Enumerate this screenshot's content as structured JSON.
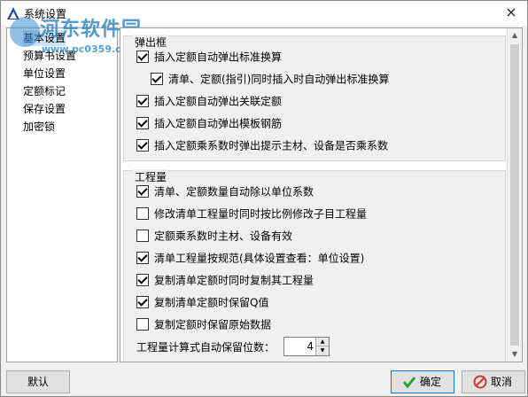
{
  "window": {
    "title": "系统设置",
    "close_glyph": "×"
  },
  "watermark": {
    "text": "河东软件园",
    "url": "www.pc0359.cn"
  },
  "sidebar": {
    "items": [
      {
        "label": "基本设置",
        "selected": true
      },
      {
        "label": "预算书设置",
        "selected": false
      },
      {
        "label": "单位设置",
        "selected": false
      },
      {
        "label": "定额标记",
        "selected": false
      },
      {
        "label": "保存设置",
        "selected": false
      },
      {
        "label": "加密锁",
        "selected": false
      }
    ]
  },
  "popup_group": {
    "title": "弹出框",
    "options": [
      {
        "label": "插入定额自动弹出标准换算",
        "checked": true
      },
      {
        "label": "清单、定额(指引)同时插入时自动弹出标准换算",
        "checked": true
      },
      {
        "label": "插入定额自动弹出关联定额",
        "checked": true
      },
      {
        "label": "插入定额自动弹出模板钢筋",
        "checked": true
      },
      {
        "label": "插入定额乘系数时弹出提示主材、设备是否乘系数",
        "checked": true
      }
    ]
  },
  "quantity_group": {
    "title": "工程量",
    "options": [
      {
        "label": "清单、定额数量自动除以单位系数",
        "checked": true
      },
      {
        "label": "修改清单工程量时同时按比例修改子目工程量",
        "checked": false
      },
      {
        "label": "定额乘系数时主材、设备有效",
        "checked": false
      },
      {
        "label": "清单工程量按规范(具体设置查看：单位设置)",
        "checked": true
      },
      {
        "label": "复制清单定额时同时复制其工程量",
        "checked": true
      },
      {
        "label": "复制清单定额时保留Q值",
        "checked": true
      },
      {
        "label": "复制定额时保留原始数据",
        "checked": false
      }
    ],
    "decimals_label": "工程量计算式自动保留位数：",
    "decimals_value": "4"
  },
  "buttons": {
    "default": "默认",
    "ok": "确定",
    "cancel": "取消"
  },
  "colors": {
    "selection": "#cce4f7",
    "ok_icon": "#2e9e2e",
    "cancel_icon": "#d03a2a"
  }
}
